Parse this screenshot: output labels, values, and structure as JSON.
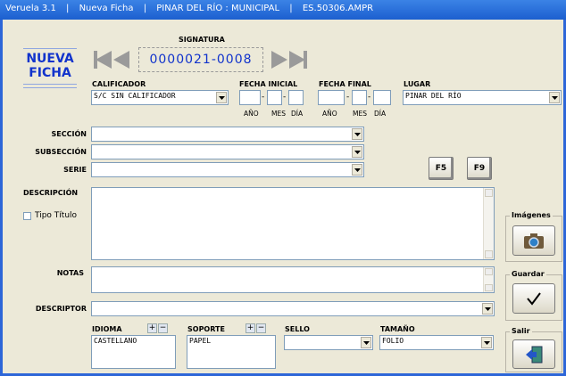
{
  "title": {
    "app": "Veruela 3.1",
    "sep": "|",
    "mode": "Nueva Ficha",
    "place": "PINAR DEL RÍO : MUNICIPAL",
    "code": "ES.50306.AMPR"
  },
  "logo": {
    "line1": "NUEVA",
    "line2": "FICHA"
  },
  "signatura": {
    "label": "SIGNATURA",
    "value": "0000021-0008"
  },
  "calificador": {
    "label": "CALIFICADOR",
    "value": "S/C SIN CALIFICADOR"
  },
  "fecha_inicial": {
    "label": "FECHA INICIAL",
    "anio": "AÑO",
    "mes": "MES",
    "dia": "DÍA"
  },
  "fecha_final": {
    "label": "FECHA FINAL",
    "anio": "AÑO",
    "mes": "MES",
    "dia": "DÍA"
  },
  "lugar": {
    "label": "LUGAR",
    "value": "PINAR DEL RÍO"
  },
  "seccion": {
    "label": "SECCIÓN",
    "value": ""
  },
  "subseccion": {
    "label": "SUBSECCIÓN",
    "value": ""
  },
  "serie": {
    "label": "SERIE",
    "value": ""
  },
  "keys": {
    "f5": "F5",
    "f9": "F9"
  },
  "descripcion": {
    "label": "DESCRIPCIÓN"
  },
  "tipo_titulo": {
    "label": "Tipo Título"
  },
  "notas": {
    "label": "NOTAS"
  },
  "descriptor": {
    "label": "DESCRIPTOR",
    "value": ""
  },
  "idioma": {
    "label": "IDIOMA",
    "items": [
      "CASTELLANO"
    ]
  },
  "soporte": {
    "label": "SOPORTE",
    "items": [
      "PAPEL"
    ]
  },
  "sello": {
    "label": "SELLO",
    "value": ""
  },
  "tamano": {
    "label": "TAMAÑO",
    "value": "FOLIO"
  },
  "side": {
    "imagenes": "Imágenes",
    "guardar": "Guardar",
    "salir": "Salir"
  },
  "colors": {
    "title": "#1c5fcf",
    "accent": "#1133cc",
    "frame": "#ece9d8"
  }
}
